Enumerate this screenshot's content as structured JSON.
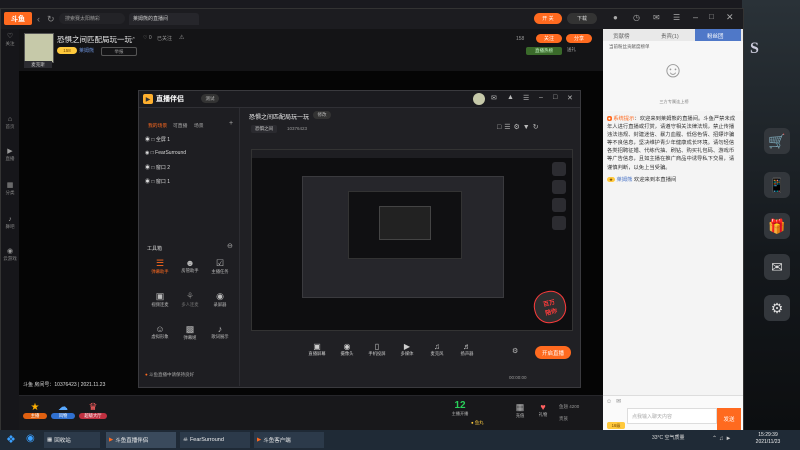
{
  "app": {
    "logo": "斗鱼",
    "search_placeholder": "搜索赛太阳精彩",
    "tabs": [
      "莱姆熊的直播间"
    ],
    "colors": {
      "accent": "#ff6a1f",
      "brand_blue": "#1677ff"
    }
  },
  "rail": [
    {
      "icon": "home-icon",
      "label": "首页"
    },
    {
      "icon": "live-icon",
      "label": "直播"
    },
    {
      "icon": "category-icon",
      "label": "分类"
    },
    {
      "icon": "dance-icon",
      "label": "舞吧"
    },
    {
      "icon": "game-icon",
      "label": "云游戏"
    }
  ],
  "rail_top": "关注",
  "room": {
    "title": "恐惧之间匹配局玩一玩",
    "host": "麦克斯",
    "host_badge": "莱姆熊",
    "follow_count": "0",
    "followers": "已关注",
    "tag": "恐惧之间",
    "room_id": "10376423",
    "btn_follow": "关注",
    "btn_gift": "分享",
    "level": "158",
    "rank": "送礼",
    "report": "举报",
    "hot_label": "直播热榜"
  },
  "video": {
    "watermark": "斗鱼 房间号：10376423 | 2021.11.23",
    "inner_app_title": "直播伴侣",
    "inner_room_title": "恐惧之间匹配局玩一玩",
    "inner_tag": "恐惧之间",
    "inner_room_num": "10376423",
    "scenes_header": [
      "我的场景",
      "可直播",
      "场景"
    ],
    "scenes": [
      "全屏 1",
      "FearSurround",
      "窗口 2",
      "窗口 1"
    ],
    "tools_header": "工具箱",
    "tools": [
      "弹幕助手",
      "房管助手",
      "主播任务",
      "视频连麦",
      "多人连麦",
      "录屏器",
      "虚拟形象",
      "弹幕姬",
      "歌词展示"
    ],
    "inner_bottom": [
      "直播屏幕",
      "摄像头",
      "手机投屏",
      "多媒体",
      "麦克风",
      "扬声器"
    ],
    "inner_start": "开启直播",
    "inner_timer": "00:00:00",
    "inner_status": "斗鱼直播中请保持良好",
    "stamp": "百万\n陪你"
  },
  "bottom": {
    "left_items": [
      "主播",
      "风物",
      "超级大厅"
    ],
    "count_num": "12",
    "count_label": "主播开播",
    "yuwan": "鱼丸",
    "side": [
      "充值",
      "礼物"
    ],
    "balance_label": "鱼翅",
    "balance": "4200",
    "vip_label": "贵族"
  },
  "chat": {
    "tabs": [
      "贡献榜",
      "贵宾(1)",
      "粉丝团"
    ],
    "poster_caption": "当前粉丝贡献度榜单",
    "avatar_caption": "三方专属连上榜",
    "system_label": "系统提示",
    "system_msg": "欢迎来到莱姆熊的直播间。斗鱼严禁未成年人进行直播或打赏，请遵守相关法律法规，禁止传播违法违规、封建迷信、暴力血腥、低俗色情、招嫖诈骗等不良信息，坚决维护青少年健康成长环境。请勿轻信各类招聘征婚、代练代抽、刷钻、购买礼包码、游戏币等广告信息，且如主播在推广商品中诱导私下交易，请谨慎判断，以免上当受骗。",
    "user_msg_user": "莱姆熊",
    "user_msg": "欢迎来到本直播间",
    "input_placeholder": "点我输入聊天内容",
    "send": "发送",
    "input_level": "16级"
  },
  "taskbar": {
    "apps": [
      "回收站",
      "斗鱼直播伴侣",
      "FearSurround",
      "斗鱼客户端"
    ],
    "weather": "33°C 空气质量",
    "time": "15:29:39",
    "date": "2021/11/23"
  }
}
